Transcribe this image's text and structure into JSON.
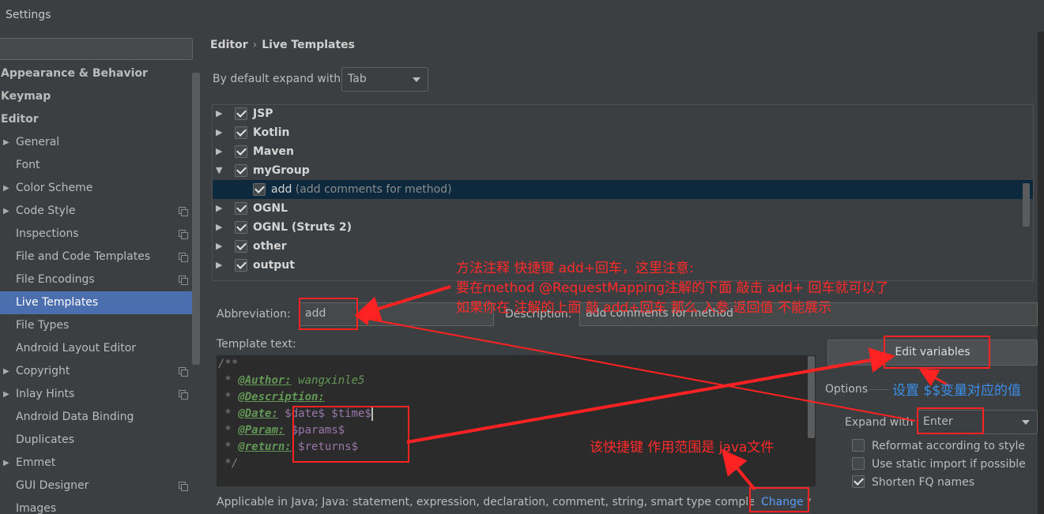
{
  "window": {
    "title": "Settings"
  },
  "sidebar": {
    "items": [
      {
        "label": "Appearance & Behavior",
        "level": "top",
        "arrow": false,
        "icon": false
      },
      {
        "label": "Keymap",
        "level": "top",
        "arrow": false,
        "icon": false
      },
      {
        "label": "Editor",
        "level": "top",
        "arrow": false,
        "icon": false
      },
      {
        "label": "General",
        "level": "child",
        "arrow": true,
        "icon": false
      },
      {
        "label": "Font",
        "level": "child",
        "arrow": false,
        "icon": false
      },
      {
        "label": "Color Scheme",
        "level": "child",
        "arrow": true,
        "icon": false
      },
      {
        "label": "Code Style",
        "level": "child",
        "arrow": true,
        "icon": true
      },
      {
        "label": "Inspections",
        "level": "child",
        "arrow": false,
        "icon": true
      },
      {
        "label": "File and Code Templates",
        "level": "child",
        "arrow": false,
        "icon": true
      },
      {
        "label": "File Encodings",
        "level": "child",
        "arrow": false,
        "icon": true
      },
      {
        "label": "Live Templates",
        "level": "child",
        "arrow": false,
        "icon": false,
        "selected": true
      },
      {
        "label": "File Types",
        "level": "child",
        "arrow": false,
        "icon": false
      },
      {
        "label": "Android Layout Editor",
        "level": "child",
        "arrow": false,
        "icon": false
      },
      {
        "label": "Copyright",
        "level": "child",
        "arrow": true,
        "icon": true
      },
      {
        "label": "Inlay Hints",
        "level": "child",
        "arrow": true,
        "icon": true
      },
      {
        "label": "Android Data Binding",
        "level": "child",
        "arrow": false,
        "icon": false
      },
      {
        "label": "Duplicates",
        "level": "child",
        "arrow": false,
        "icon": false
      },
      {
        "label": "Emmet",
        "level": "child",
        "arrow": true,
        "icon": false
      },
      {
        "label": "GUI Designer",
        "level": "child",
        "arrow": false,
        "icon": true
      },
      {
        "label": "Images",
        "level": "child",
        "arrow": false,
        "icon": false
      }
    ]
  },
  "breadcrumb": {
    "part1": "Editor",
    "separator": "›",
    "part2": "Live Templates"
  },
  "expand_default": {
    "label": "By default expand with",
    "value": "Tab"
  },
  "tree": {
    "rows": [
      {
        "name": "JSP",
        "expanded": false,
        "checked": true
      },
      {
        "name": "Kotlin",
        "expanded": false,
        "checked": true
      },
      {
        "name": "Maven",
        "expanded": false,
        "checked": true
      },
      {
        "name": "myGroup",
        "expanded": true,
        "checked": true
      },
      {
        "name": "add",
        "desc": "(add comments for method)",
        "child": true,
        "checked": true,
        "selected": true
      },
      {
        "name": "OGNL",
        "expanded": false,
        "checked": true
      },
      {
        "name": "OGNL (Struts 2)",
        "expanded": false,
        "checked": true
      },
      {
        "name": "other",
        "expanded": false,
        "checked": true
      },
      {
        "name": "output",
        "expanded": false,
        "checked": true
      }
    ]
  },
  "abbreviation": {
    "label": "Abbreviation:",
    "value": "add"
  },
  "description": {
    "label": "Description:",
    "value": "add comments for method"
  },
  "template_text": {
    "label": "Template text:",
    "line1": "/**",
    "line2_star": " * ",
    "line2_tag": "@Author:",
    "line2_val": " wangxinle5",
    "line3_star": " * ",
    "line3_tag": "@Description:",
    "line4_star": " * ",
    "line4_tag": "@Date:",
    "line4_var": " $date$ $time$",
    "line5_star": " * ",
    "line5_tag": "@Param:",
    "line5_var": " $params$",
    "line6_star": " * ",
    "line6_tag": "@return:",
    "line6_var": " $returns$",
    "line7": " */"
  },
  "edit_variables": {
    "label": "Edit variables"
  },
  "options": {
    "label": "Options",
    "expand_with_label": "Expand with",
    "expand_with_value": "Enter",
    "reformat": {
      "label": "Reformat according to style",
      "checked": false
    },
    "static_import": {
      "label": "Use static import if possible",
      "checked": false
    },
    "shorten": {
      "label": "Shorten FQ names",
      "checked": true
    }
  },
  "applicable": {
    "text": "Applicable in Java; Java: statement, expression, declaration, comment, string, smart type completion...",
    "change_label": "Change"
  },
  "annotations": {
    "note1_line1": "方法注释 快捷键 add+回车，这里注意:",
    "note1_line2": "要在method @RequestMapping注解的下面 敲击 add+ 回车就可以了",
    "note1_line3": "如果你在 注解的上面 敲 add+回车 那么 入参 返回值 不能展示",
    "note_vars": "设置 $$变量对应的值",
    "note_scope": "该快捷键  作用范围是 java文件"
  },
  "colors": {
    "annotation_red": "#ff2a2a",
    "annotation_blue": "#3b8fe8",
    "selection": "#4b6eaf"
  }
}
